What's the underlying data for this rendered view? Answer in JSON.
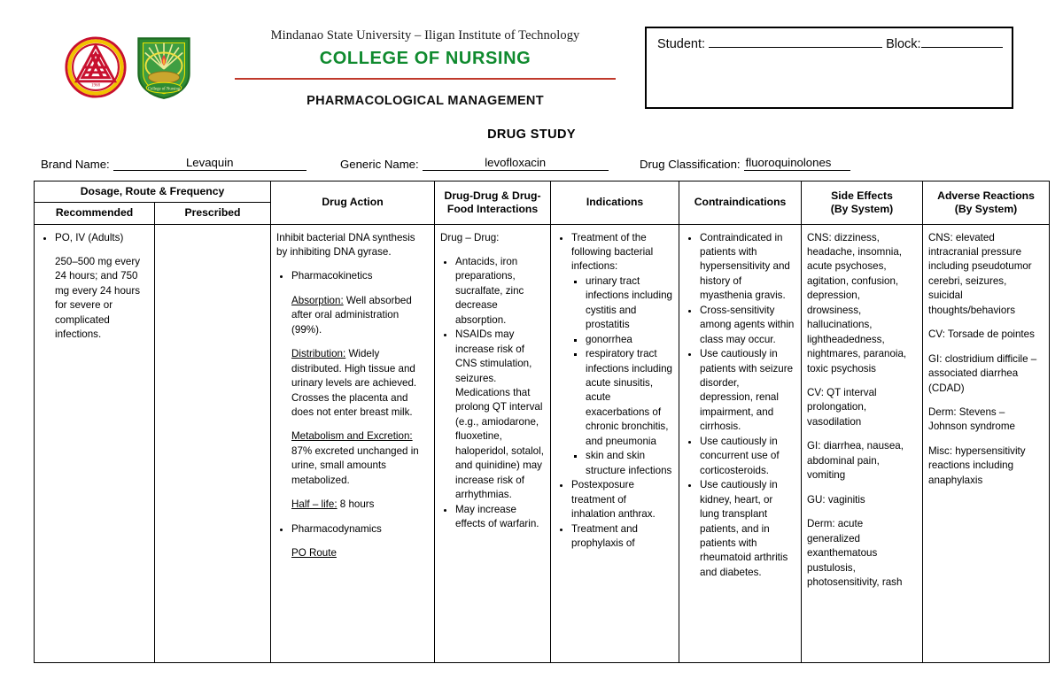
{
  "header": {
    "university": "Mindanao State University – Iligan Institute of Technology",
    "college": "COLLEGE OF NURSING",
    "document_subtitle": "PHARMACOLOGICAL MANAGEMENT",
    "document_title": "DRUG STUDY",
    "student_label": "Student:",
    "student_value": "",
    "block_label": "Block:",
    "block_value": ""
  },
  "drug_info": {
    "brand_label": "Brand Name:",
    "brand_value": "Levaquin",
    "generic_label": "Generic Name:",
    "generic_value": "levofloxacin",
    "classification_label": "Drug Classification:",
    "classification_value": "fluoroquinolones"
  },
  "table": {
    "headers": {
      "dosage_group": "Dosage, Route & Frequency",
      "recommended": "Recommended",
      "prescribed": "Prescribed",
      "drug_action": "Drug Action",
      "interactions_line1": "Drug-Drug & Drug-",
      "interactions_line2": "Food Interactions",
      "indications": "Indications",
      "contraindications": "Contraindications",
      "side_effects_line1": "Side Effects",
      "side_effects_line2": "(By System)",
      "adverse_line1": "Adverse Reactions",
      "adverse_line2": "(By System)"
    },
    "recommended": {
      "bullet": "PO, IV (Adults)",
      "detail": "250–500 mg every 24 hours; and 750 mg every 24 hours for severe or complicated infections."
    },
    "prescribed": {
      "value": ""
    },
    "drug_action": {
      "intro": "Inhibit bacterial DNA synthesis by inhibiting DNA gyrase.",
      "pharmacokinetics_label": "Pharmacokinetics",
      "absorption_label": "Absorption:",
      "absorption_text": " Well absorbed after oral administration (99%).",
      "distribution_label": "Distribution:",
      "distribution_text": " Widely distributed. High tissue and urinary levels are achieved. Crosses the placenta and does not enter breast milk.",
      "metabolism_label": "Metabolism and Excretion:",
      "metabolism_text": " 87% excreted unchanged in urine, small amounts metabolized.",
      "halflife_label": "Half – life:",
      "halflife_text": " 8 hours",
      "pharmacodynamics_label": "Pharmacodynamics",
      "po_route_label": "PO Route"
    },
    "interactions": {
      "heading": "Drug – Drug:",
      "items": [
        "Antacids, iron preparations, sucralfate, zinc decrease absorption.",
        "NSAIDs may increase risk of CNS stimulation, seizures. Medications that prolong QT interval (e.g., amiodarone, fluoxetine, haloperidol, sotalol, and quinidine) may increase risk of arrhythmias.",
        "May increase effects of warfarin."
      ]
    },
    "indications": {
      "item1": "Treatment of the following bacterial infections:",
      "subitems": [
        "urinary tract infections including cystitis and prostatitis",
        "gonorrhea",
        "respiratory tract infections including acute sinusitis, acute exacerbations of chronic bronchitis, and pneumonia",
        "skin and skin structure infections"
      ],
      "item2": "Postexposure treatment of inhalation anthrax.",
      "item3": "Treatment and prophylaxis of"
    },
    "contraindications": {
      "items": [
        "Contraindicated in patients with hypersensitivity and history of myasthenia gravis.",
        "Cross-sensitivity among agents within class may occur.",
        "Use cautiously in patients with seizure disorder, depression, renal impairment, and cirrhosis.",
        "Use cautiously in concurrent use of corticosteroids.",
        "Use cautiously in kidney, heart, or lung transplant patients, and in patients with rheumatoid arthritis and diabetes."
      ]
    },
    "side_effects": {
      "paragraphs": [
        "CNS: dizziness, headache, insomnia, acute psychoses, agitation, confusion, depression, drowsiness, hallucinations, lightheadedness, nightmares, paranoia, toxic psychosis",
        "CV: QT interval prolongation, vasodilation",
        "GI: diarrhea, nausea, abdominal pain, vomiting",
        "GU: vaginitis",
        "Derm: acute generalized exanthematous pustulosis, photosensitivity, rash"
      ]
    },
    "adverse_reactions": {
      "paragraphs": [
        "CNS: elevated intracranial pressure including pseudotumor cerebri, seizures, suicidal thoughts/behaviors",
        "CV: Torsade de pointes",
        "GI: clostridium difficile – associated diarrhea (CDAD)",
        "Derm: Stevens – Johnson syndrome",
        "Misc: hypersensitivity reactions including anaphylaxis"
      ]
    }
  },
  "colors": {
    "college_green": "#0f8a2e",
    "rule_red": "#c0392b",
    "text_black": "#000000"
  }
}
